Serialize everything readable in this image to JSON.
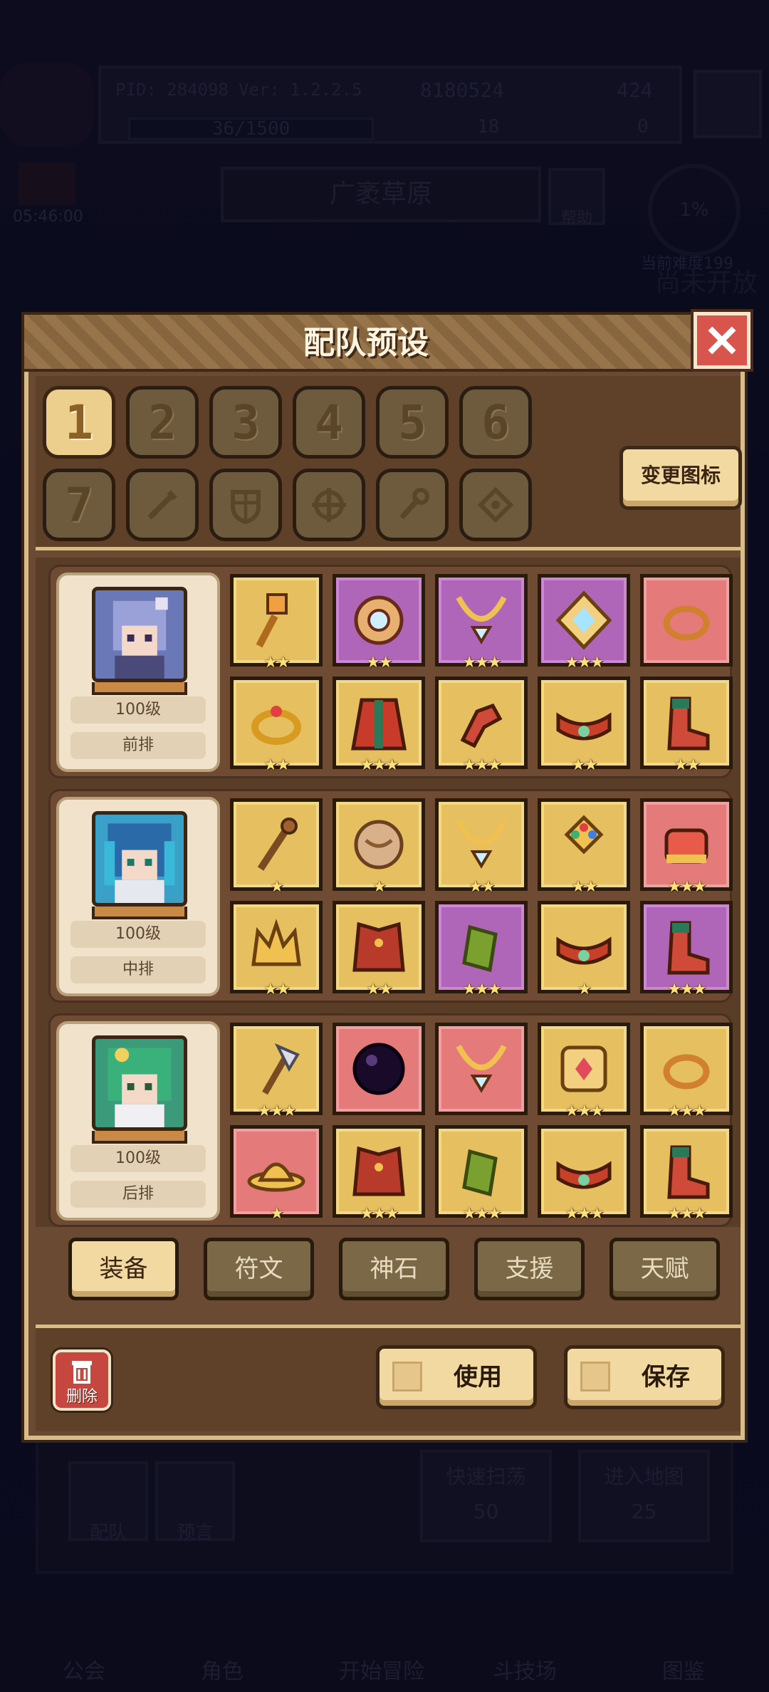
{
  "background": {
    "pid": "PID: 284098",
    "version": "Ver: 1.2.2.5",
    "gold": "8180524",
    "gems": "424",
    "energy": "36/1500",
    "keys": "18",
    "tickets": "0",
    "timer": "05:46:00",
    "area_name": "广袤草原",
    "help": "帮助",
    "progress": "1%",
    "difficulty": "当前难度199",
    "coming_soon": "尚未开放",
    "team_btn": "配队",
    "preview_btn": "预言",
    "quick_sweep": "快速扫荡",
    "quick_sweep_cost": "50",
    "enter_map": "进入地图",
    "enter_map_cost": "25",
    "nav": {
      "guild": "公会",
      "character": "角色",
      "start": "开始冒险",
      "arena": "斗技场",
      "codex": "图鉴"
    }
  },
  "dialog": {
    "title": "配队预设",
    "change_icon": "变更图标",
    "presets": [
      "1",
      "2",
      "3",
      "4",
      "5",
      "6",
      "7"
    ],
    "preset_icons": [
      "sword-icon",
      "shield-icon",
      "compass-icon",
      "staff-icon",
      "gem-cross-icon"
    ],
    "active_preset": "1",
    "teams": [
      {
        "level": "100级",
        "position": "前排",
        "portrait_color": "#6a78b8",
        "equipment": [
          {
            "icon": "mace-icon",
            "rarity": "gold",
            "stars": "★★"
          },
          {
            "icon": "round-shield-icon",
            "rarity": "purple",
            "stars": "★★"
          },
          {
            "icon": "heart-necklace-icon",
            "rarity": "purple",
            "stars": "★★★"
          },
          {
            "icon": "diamond-gem-icon",
            "rarity": "purple",
            "stars": "★★★"
          },
          {
            "icon": "ring-icon",
            "rarity": "red",
            "stars": ""
          },
          {
            "icon": "gold-ring-icon",
            "rarity": "gold",
            "stars": "★★"
          },
          {
            "icon": "robe-armor-icon",
            "rarity": "gold",
            "stars": "★★★"
          },
          {
            "icon": "gauntlet-icon",
            "rarity": "gold",
            "stars": "★★★"
          },
          {
            "icon": "belt-icon",
            "rarity": "gold",
            "stars": "★★"
          },
          {
            "icon": "boots-icon",
            "rarity": "gold",
            "stars": "★★"
          }
        ]
      },
      {
        "level": "100级",
        "position": "中排",
        "portrait_color": "#3aa0c8",
        "equipment": [
          {
            "icon": "staff-icon",
            "rarity": "gold",
            "stars": "★"
          },
          {
            "icon": "orb-icon",
            "rarity": "gold",
            "stars": "★"
          },
          {
            "icon": "heart-necklace-icon",
            "rarity": "gold",
            "stars": "★★"
          },
          {
            "icon": "cross-amulet-icon",
            "rarity": "gold",
            "stars": "★★"
          },
          {
            "icon": "crown-ring-icon",
            "rarity": "red",
            "stars": "★★★"
          },
          {
            "icon": "crown-icon",
            "rarity": "gold",
            "stars": "★★"
          },
          {
            "icon": "chest-armor-icon",
            "rarity": "gold",
            "stars": "★★"
          },
          {
            "icon": "bracer-icon",
            "rarity": "purple",
            "stars": "★★★"
          },
          {
            "icon": "belt-icon",
            "rarity": "gold",
            "stars": "★"
          },
          {
            "icon": "boots-icon",
            "rarity": "purple",
            "stars": "★★★"
          }
        ]
      },
      {
        "level": "100级",
        "position": "后排",
        "portrait_color": "#3a9a7a",
        "equipment": [
          {
            "icon": "axe-icon",
            "rarity": "gold",
            "stars": "★★★"
          },
          {
            "icon": "dark-orb-icon",
            "rarity": "red",
            "stars": ""
          },
          {
            "icon": "heart-necklace-icon",
            "rarity": "red",
            "stars": ""
          },
          {
            "icon": "ornate-emblem-icon",
            "rarity": "gold",
            "stars": "★★★"
          },
          {
            "icon": "ring-icon",
            "rarity": "gold",
            "stars": "★★★"
          },
          {
            "icon": "hat-icon",
            "rarity": "red",
            "stars": "★"
          },
          {
            "icon": "chest-armor-icon",
            "rarity": "gold",
            "stars": "★★★"
          },
          {
            "icon": "bracer-icon",
            "rarity": "gold",
            "stars": "★★★"
          },
          {
            "icon": "belt-icon",
            "rarity": "gold",
            "stars": "★★★"
          },
          {
            "icon": "boots-icon",
            "rarity": "gold",
            "stars": "★★★"
          }
        ]
      }
    ],
    "tabs": [
      "装备",
      "符文",
      "神石",
      "支援",
      "天赋"
    ],
    "active_tab": "装备",
    "delete": "删除",
    "use": "使用",
    "save": "保存"
  }
}
